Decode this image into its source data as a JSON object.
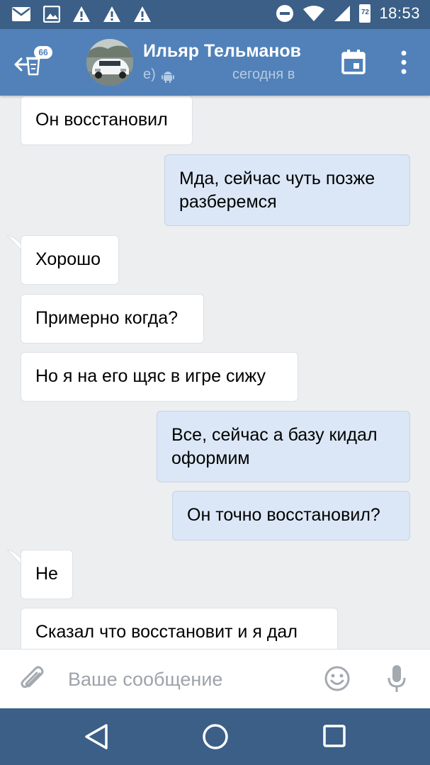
{
  "status_bar": {
    "time": "18:53",
    "battery_level": "72",
    "icons_left": [
      "mail-icon",
      "image-icon",
      "warning-icon",
      "warning-icon",
      "warning-icon"
    ],
    "icons_right": [
      "do-not-disturb-icon",
      "wifi-icon",
      "signal-icon",
      "battery-icon"
    ]
  },
  "header": {
    "back_badge": "66",
    "contact_name": "Ильяр Тельманов",
    "status_fragment": "е)",
    "status_time": "сегодня в",
    "colors": {
      "bar": "#5181b8",
      "status_bar": "#3b5f87",
      "status_text": "#b5cae3"
    }
  },
  "messages": [
    {
      "direction": "in",
      "lines": [
        "Он восстановил"
      ]
    },
    {
      "direction": "out",
      "lines": [
        "Мда, сейчас чуть позже",
        "разберемся"
      ]
    },
    {
      "direction": "in",
      "lines": [
        "Хорошо"
      ]
    },
    {
      "direction": "in",
      "lines": [
        "Примерно когда?"
      ]
    },
    {
      "direction": "in",
      "lines": [
        "Но я на его щяс в игре сижу"
      ]
    },
    {
      "direction": "out",
      "lines": [
        "Все, сейчас а базу кидал",
        "оформим"
      ]
    },
    {
      "direction": "out",
      "lines": [
        "Он точно восстановил?"
      ]
    },
    {
      "direction": "in",
      "lines": [
        "Не"
      ]
    },
    {
      "direction": "in",
      "lines": [
        "Сказал что восстановит и я дал"
      ]
    }
  ],
  "composer": {
    "placeholder": "Ваше сообщение",
    "value": ""
  },
  "colors": {
    "chat_background": "#edeef0",
    "incoming_bubble": "#ffffff",
    "outgoing_bubble": "#dbe7f6",
    "nav_bar": "#3b5f87",
    "icon_gray": "#a4a9b0"
  }
}
